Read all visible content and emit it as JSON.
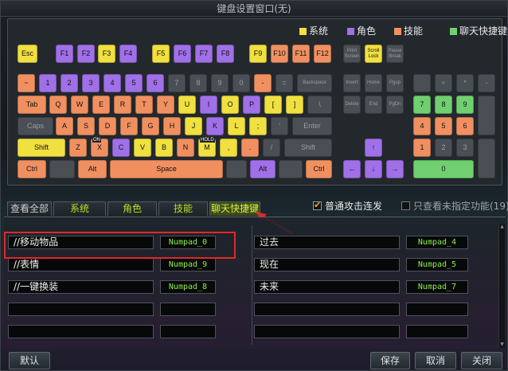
{
  "window": {
    "title": "键盘设置窗口(无)"
  },
  "legend": [
    {
      "label": "系统",
      "color": "#f0e040"
    },
    {
      "label": "角色",
      "color": "#a070e8"
    },
    {
      "label": "技能",
      "color": "#f09060"
    },
    {
      "label": "聊天快捷键",
      "color": "#70d070"
    }
  ],
  "keyboard": {
    "esc": "Esc",
    "f_row": [
      "F1",
      "F2",
      "F3",
      "F4",
      "F5",
      "F6",
      "F7",
      "F8",
      "F9",
      "F10",
      "F11",
      "F12"
    ],
    "sys_keys": [
      "Print Screen",
      "Scroll Lock",
      "Pause Break"
    ],
    "num_row": [
      "~",
      "1",
      "2",
      "3",
      "4",
      "5",
      "6",
      "7",
      "8",
      "9",
      "0",
      "-",
      "=",
      "Backspace"
    ],
    "q_row": [
      "Tab",
      "Q",
      "W",
      "E",
      "R",
      "T",
      "Y",
      "U",
      "I",
      "O",
      "P",
      "[",
      "]",
      "\\"
    ],
    "a_row": [
      "Caps",
      "A",
      "S",
      "D",
      "F",
      "G",
      "H",
      "J",
      "K",
      "L",
      ";",
      "'",
      "Enter"
    ],
    "z_row": [
      "Shift",
      "Z",
      "X",
      "C",
      "V",
      "B",
      "N",
      "M",
      ",",
      ".",
      "/",
      "Shift"
    ],
    "bottom_row": [
      "Ctrl",
      "Alt",
      "Space",
      "Alt",
      "Ctrl"
    ],
    "superscripts": {
      "x": "ON",
      "m": "HOLD"
    },
    "nav_keys": [
      "Insert",
      "Home",
      "Pgup",
      "Delete",
      "End",
      "PgDn"
    ],
    "arrows": [
      "↑",
      "←",
      "↓",
      "→"
    ],
    "numpad": [
      "÷",
      "*",
      "-",
      "7",
      "8",
      "9",
      "4",
      "5",
      "6",
      "1",
      "2",
      "3",
      "0"
    ]
  },
  "tabs": [
    {
      "label": "查看全部"
    },
    {
      "label": "系统"
    },
    {
      "label": "角色"
    },
    {
      "label": "技能"
    },
    {
      "label": "聊天快捷键",
      "active": true
    }
  ],
  "options": {
    "normal_attack": {
      "label": "普通攻击连发",
      "checked": true
    },
    "unassigned_only": {
      "label": "只查看未指定功能(19)",
      "checked": false
    }
  },
  "bindings_left": [
    {
      "name": "//移动物品",
      "key": "Numpad_0"
    },
    {
      "name": "//表情",
      "key": "Numpad_9"
    },
    {
      "name": "//一键换装",
      "key": "Numpad_8"
    },
    {
      "name": "",
      "key": ""
    },
    {
      "name": "",
      "key": ""
    }
  ],
  "bindings_right": [
    {
      "name": "过去",
      "key": "Numpad_4"
    },
    {
      "name": "现在",
      "key": "Numpad_5"
    },
    {
      "name": "未来",
      "key": "Numpad_7"
    },
    {
      "name": "",
      "key": ""
    },
    {
      "name": "",
      "key": ""
    }
  ],
  "buttons": {
    "default": "默认",
    "save": "保存",
    "cancel": "取消",
    "close": "关闭"
  },
  "colors": {
    "highlight": "#e02828",
    "key_text": "#8ef04a"
  }
}
